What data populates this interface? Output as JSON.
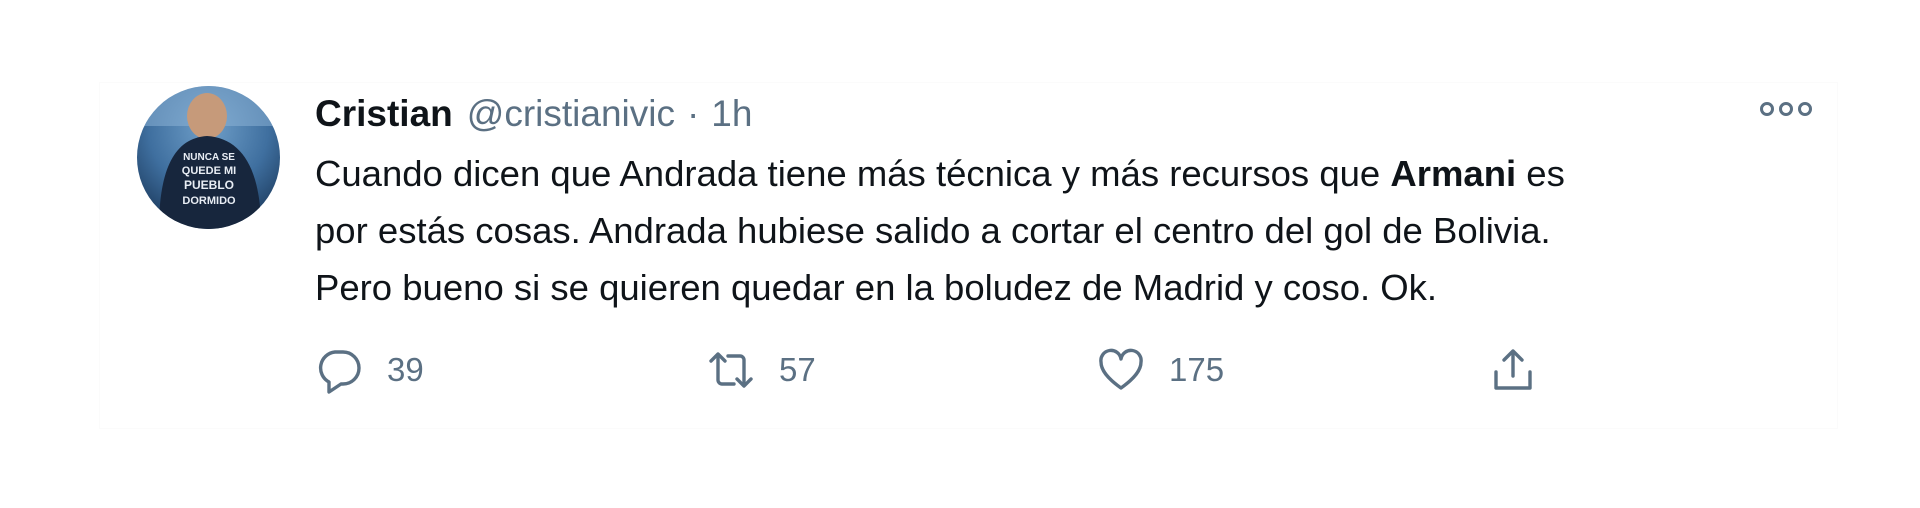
{
  "tweet": {
    "author_name": "Cristian",
    "author_handle": "@cristianivic",
    "separator": "·",
    "timestamp": "1h",
    "text": {
      "line1_before": "Cuando dicen que Andrada tiene más técnica y más recursos que ",
      "line1_bold": "Armani",
      "line1_after": " es",
      "line2": "por estás cosas. Andrada hubiese salido a cortar el centro del gol de Bolivia.",
      "line3": "Pero bueno si se quieren quedar en la boludez de Madrid y coso. Ok."
    },
    "avatar_shirt_text": [
      "NUNCA SE",
      "QUEDE MI",
      "PUEBLO",
      "DORMIDO"
    ]
  },
  "actions": {
    "reply": {
      "count": "39",
      "icon": "reply-icon"
    },
    "retweet": {
      "count": "57",
      "icon": "retweet-icon"
    },
    "like": {
      "count": "175",
      "icon": "heart-icon"
    },
    "share": {
      "icon": "share-icon"
    }
  },
  "colors": {
    "text": "#0f1419",
    "muted": "#5b7083",
    "icon": "#5b7083"
  }
}
